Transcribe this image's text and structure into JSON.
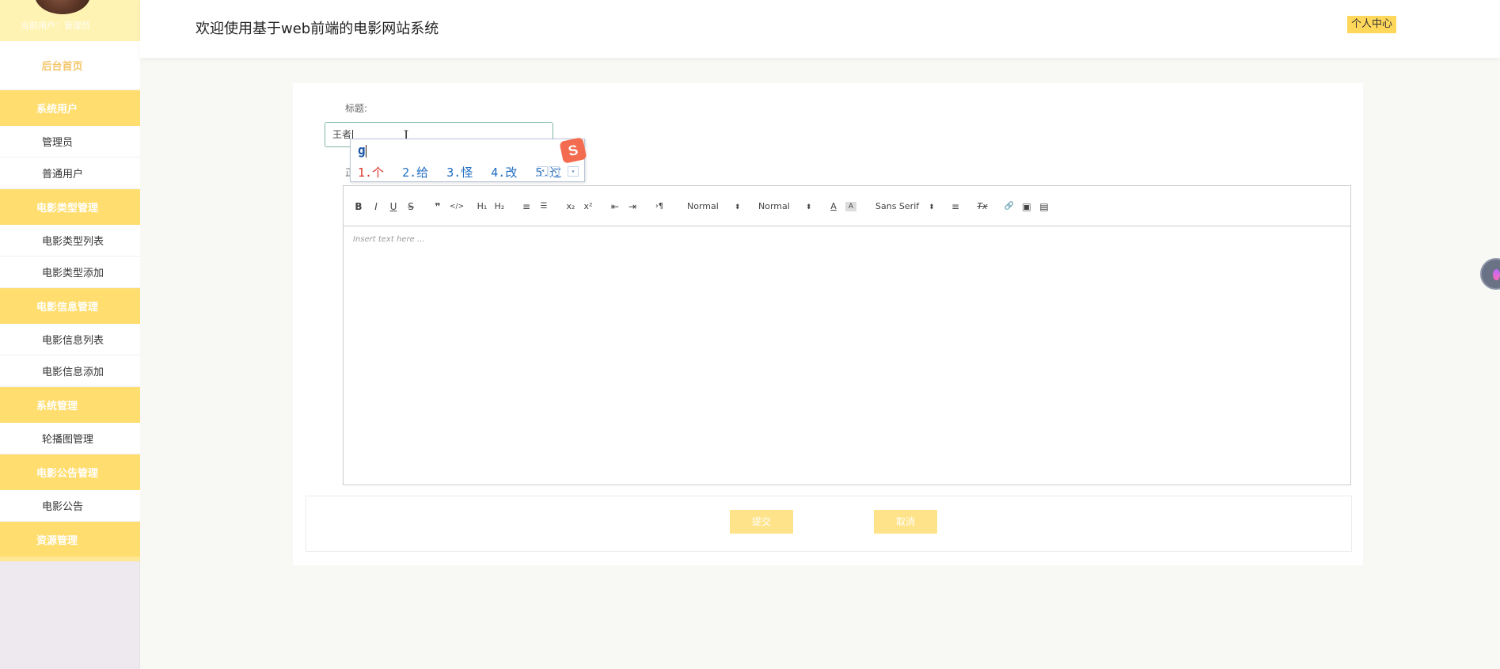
{
  "sidebar": {
    "user": "当前用户：管理员",
    "home": "后台首页",
    "groups": [
      {
        "label": "系统用户",
        "items": [
          "管理员",
          "普通用户"
        ]
      },
      {
        "label": "电影类型管理",
        "items": [
          "电影类型列表",
          "电影类型添加"
        ]
      },
      {
        "label": "电影信息管理",
        "items": [
          "电影信息列表",
          "电影信息添加"
        ]
      },
      {
        "label": "系统管理",
        "items": [
          "轮播图管理"
        ]
      },
      {
        "label": "电影公告管理",
        "items": [
          "电影公告"
        ]
      },
      {
        "label": "资源管理",
        "items": []
      }
    ]
  },
  "header": {
    "title": "欢迎使用基于web前端的电影网站系统",
    "user_center": "个人中心"
  },
  "form": {
    "title_label": "标题:",
    "title_value": "王者",
    "content_label_fragment": "正"
  },
  "ime": {
    "code": "g",
    "candidates": [
      "1.个",
      "2.给",
      "3.怪",
      "4.改",
      "5.过"
    ],
    "logo": "S"
  },
  "editor": {
    "toolbar": {
      "bold": "B",
      "italic": "I",
      "underline": "U",
      "strike": "S",
      "quote": "❞",
      "code": "</>",
      "h1": "H₁",
      "h2": "H₂",
      "ordered": "≡",
      "bullet": "☰",
      "sub": "x₂",
      "sup": "x²",
      "outdent": "⇤",
      "indent": "⇥",
      "direction": "›¶",
      "size": "Normal",
      "header": "Normal",
      "color": "A",
      "background": "A",
      "font": "Sans Serif",
      "align": "≡",
      "clean": "Tx",
      "link": "🔗",
      "image": "▣",
      "video": "▤"
    },
    "placeholder": "Insert text here ..."
  },
  "buttons": {
    "submit": "提交",
    "cancel": "取消"
  }
}
